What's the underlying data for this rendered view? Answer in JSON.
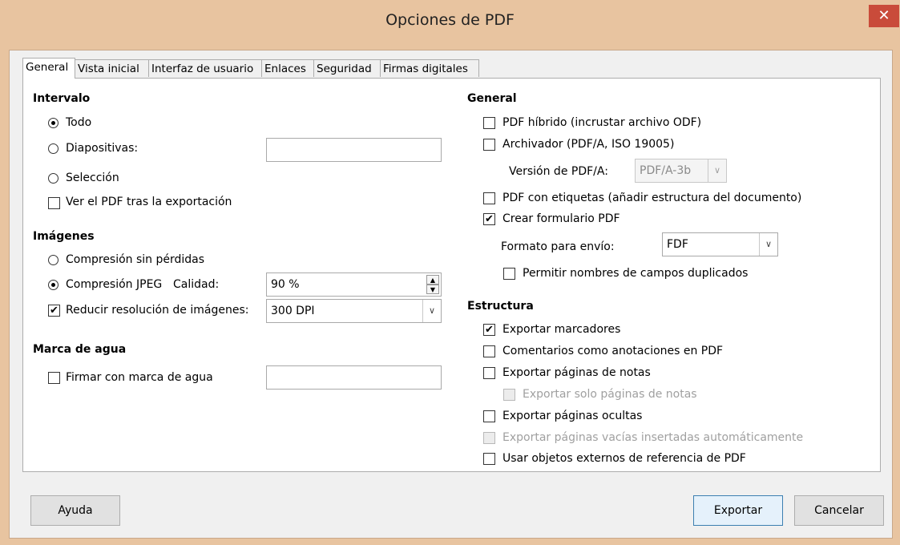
{
  "window": {
    "title": "Opciones de PDF",
    "close_glyph": "✕"
  },
  "tabs": [
    "General",
    "Vista inicial",
    "Interfaz de usuario",
    "Enlaces",
    "Seguridad",
    "Firmas digitales"
  ],
  "intervalo": {
    "heading": "Intervalo",
    "todo": "Todo",
    "diapositivas": "Diapositivas:",
    "diapositivas_value": "",
    "seleccion": "Selección",
    "ver_pdf": "Ver el PDF tras la exportación"
  },
  "imagenes": {
    "heading": "Imágenes",
    "sin_perdidas": "Compresión sin pérdidas",
    "jpeg": "Compresión JPEG",
    "calidad": "Calidad:",
    "calidad_value": "90 %",
    "reducir": "Reducir resolución de imágenes:",
    "resolucion_value": "300 DPI"
  },
  "marca": {
    "heading": "Marca de agua",
    "firmar": "Firmar con marca de agua",
    "firmar_value": ""
  },
  "general": {
    "heading": "General",
    "hibrido": "PDF híbrido (incrustar archivo ODF)",
    "archivador": "Archivador (PDF/A, ISO 19005)",
    "version_label": "Versión de PDF/A:",
    "version_value": "PDF/A-3b",
    "etiquetas": "PDF con etiquetas (añadir estructura del documento)",
    "formulario": "Crear formulario PDF",
    "formato_label": "Formato para envío:",
    "formato_value": "FDF",
    "permitir": "Permitir nombres de campos duplicados"
  },
  "estructura": {
    "heading": "Estructura",
    "marcadores": "Exportar marcadores",
    "comentarios": "Comentarios como anotaciones en PDF",
    "notas": "Exportar páginas de notas",
    "solo_notas": "Exportar solo páginas de notas",
    "ocultas": "Exportar páginas ocultas",
    "vacias": "Exportar páginas vacías insertadas automáticamente",
    "externos": "Usar objetos externos de referencia de PDF"
  },
  "buttons": {
    "ayuda": "Ayuda",
    "exportar": "Exportar",
    "cancelar": "Cancelar"
  },
  "glyphs": {
    "check": "✔",
    "dropdown": "∨",
    "spin_up": "▲",
    "spin_down": "▼"
  }
}
